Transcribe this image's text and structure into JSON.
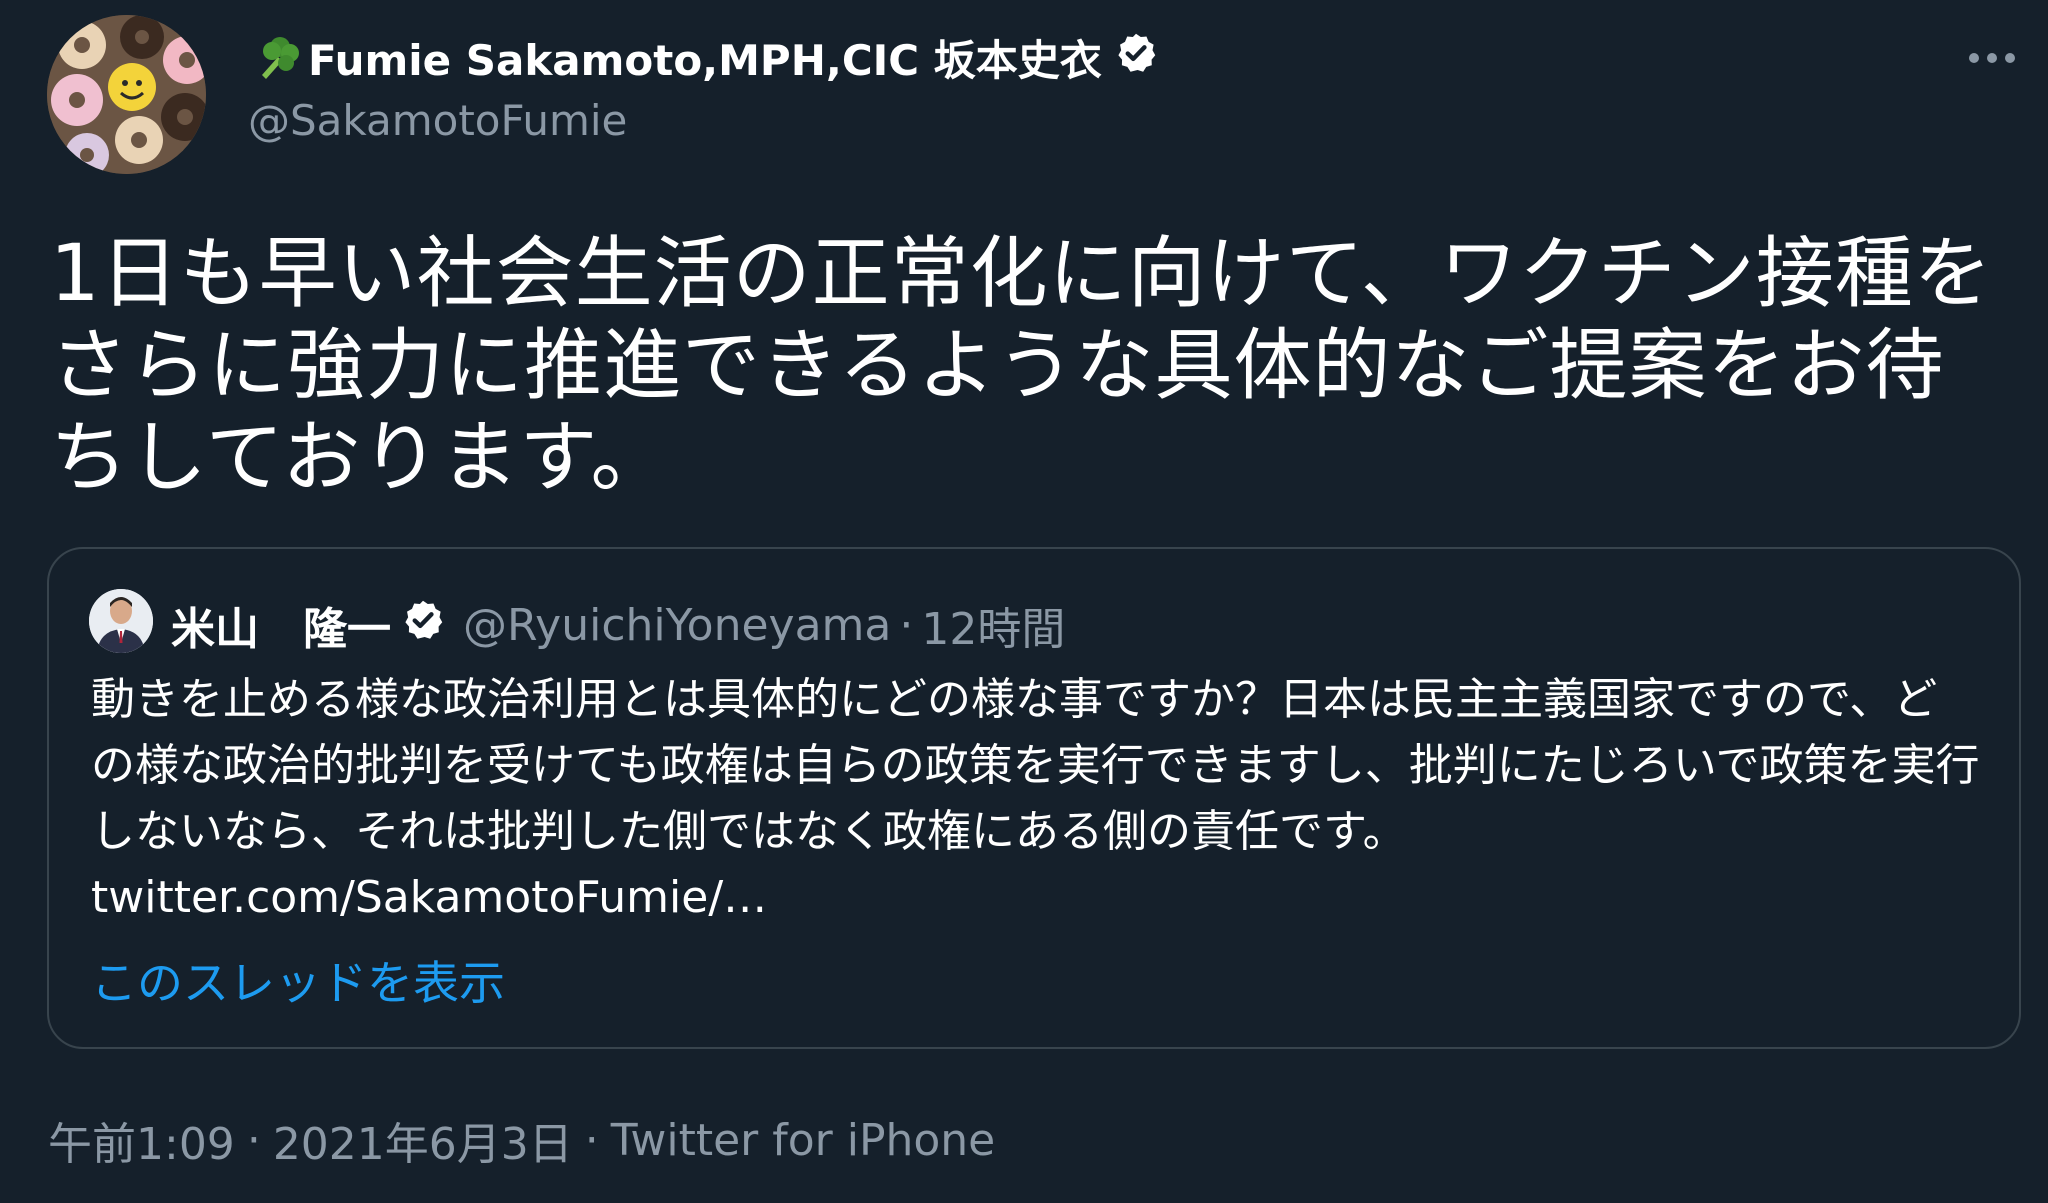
{
  "author": {
    "name": "Fumie Sakamoto,MPH,CIC 坂本史衣",
    "handle": "@SakamotoFumie",
    "name_emoji": "broccoli-icon",
    "verified_icon": "verified-badge-icon"
  },
  "tweet": {
    "text": "1日も早い社会生活の正常化に向けて、ワクチン接種をさらに強力に推進できるような具体的なご提案をお待ちしております。"
  },
  "quoted": {
    "name": "米山　隆一",
    "handle": "@RyuichiYoneyama",
    "separator": "·",
    "time": "12時間",
    "text": "動きを止める様な政治利用とは具体的にどの様な事ですか？日本は民主主義国家ですので、どの様な政治的批判を受けても政権は自らの政策を実行できますし、批判にたじろいで政策を実行しないなら、それは批判した側ではなく政権にある側の責任です。 twitter.com/SakamotoFumie/…",
    "show_thread": "このスレッドを表示"
  },
  "meta": {
    "time": "午前1:09",
    "date": "2021年6月3日",
    "source": "Twitter for iPhone",
    "separator": "·"
  },
  "colors": {
    "background": "#15202b",
    "secondary_text": "#8b98a5",
    "link": "#1d9bf0",
    "border": "#38444d"
  },
  "icons": {
    "more": "more-horizontal-icon"
  }
}
